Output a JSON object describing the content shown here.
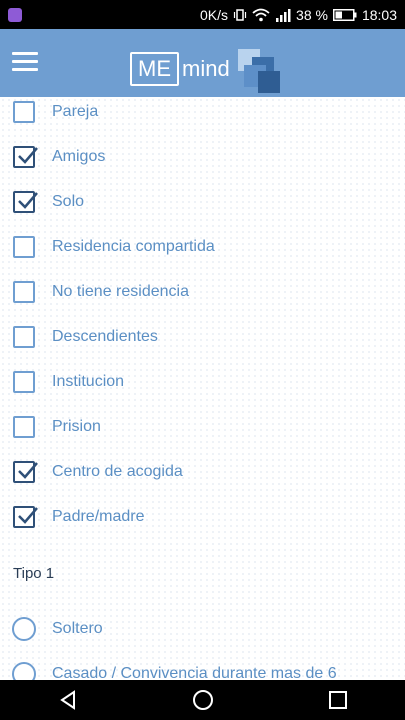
{
  "statusbar": {
    "speed": "0K/s",
    "battery": "38 %",
    "time": "18:03"
  },
  "app": {
    "logo_box_text": "ME",
    "logo_text": "mind"
  },
  "options": [
    {
      "label": "Pareja",
      "checked": false
    },
    {
      "label": "Amigos",
      "checked": true
    },
    {
      "label": "Solo",
      "checked": true
    },
    {
      "label": "Residencia compartida",
      "checked": false
    },
    {
      "label": "No tiene residencia",
      "checked": false
    },
    {
      "label": "Descendientes",
      "checked": false
    },
    {
      "label": "Institucion",
      "checked": false
    },
    {
      "label": "Prision",
      "checked": false
    },
    {
      "label": "Centro de acogida",
      "checked": true
    },
    {
      "label": "Padre/madre",
      "checked": true
    }
  ],
  "section": {
    "title": "Tipo 1",
    "radios": [
      {
        "label": "Soltero"
      },
      {
        "label": "Casado / Convivencia durante mas de 6"
      }
    ]
  },
  "colors": {
    "appbar": "#6f9ed1",
    "label_text": "#5b8fc4",
    "checkbox_checked": "#2f5078"
  }
}
